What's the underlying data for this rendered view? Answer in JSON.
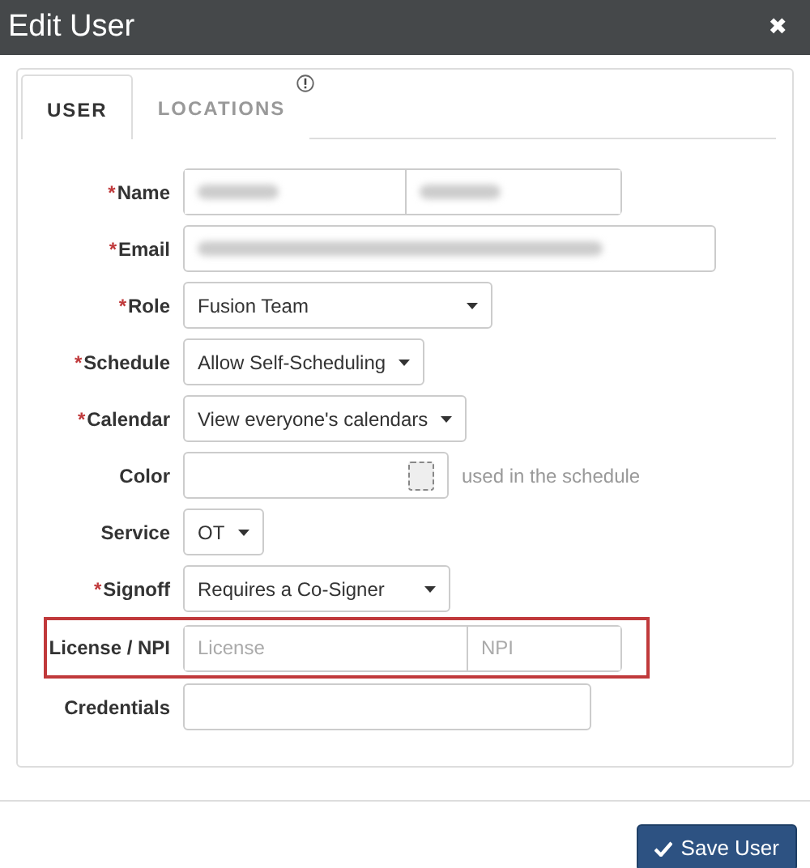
{
  "window": {
    "title": "Edit User",
    "close": "✖"
  },
  "tabs": [
    {
      "label": "USER",
      "selected": true,
      "alert": false
    },
    {
      "label": "LOCATIONS",
      "selected": false,
      "alert": true
    }
  ],
  "fields": [
    {
      "label": "Name",
      "required_mark": "*",
      "highlighted": false,
      "kind": "split",
      "inputs": [
        {
          "redacted": true
        },
        {
          "redacted": true
        }
      ]
    },
    {
      "label": "Email",
      "required_mark": "*",
      "highlighted": false,
      "kind": "text",
      "inputs": [
        {
          "redacted": true
        }
      ]
    },
    {
      "label": "Role",
      "required_mark": "*",
      "highlighted": false,
      "kind": "select",
      "value": "Fusion Team"
    },
    {
      "label": "Schedule",
      "required_mark": "*",
      "highlighted": false,
      "kind": "select",
      "value": "Allow Self-Scheduling"
    },
    {
      "label": "Calendar",
      "required_mark": "*",
      "highlighted": false,
      "kind": "select",
      "value": "View everyone's calendars"
    },
    {
      "label": "Color",
      "highlighted": false,
      "kind": "color",
      "hint": "used in the schedule"
    },
    {
      "label": "Service",
      "highlighted": false,
      "kind": "select",
      "value": "OT"
    },
    {
      "label": "Signoff",
      "required_mark": "*",
      "highlighted": false,
      "kind": "select",
      "value": "Requires a Co-Signer"
    },
    {
      "label": "License / NPI",
      "highlighted": true,
      "kind": "split",
      "inputs": [
        {
          "placeholder": "License",
          "redacted": false
        },
        {
          "placeholder": "NPI",
          "redacted": false
        }
      ]
    },
    {
      "label": "Credentials",
      "highlighted": false,
      "kind": "text",
      "inputs": [
        {
          "redacted": false
        }
      ]
    }
  ],
  "save_button": "Save User"
}
